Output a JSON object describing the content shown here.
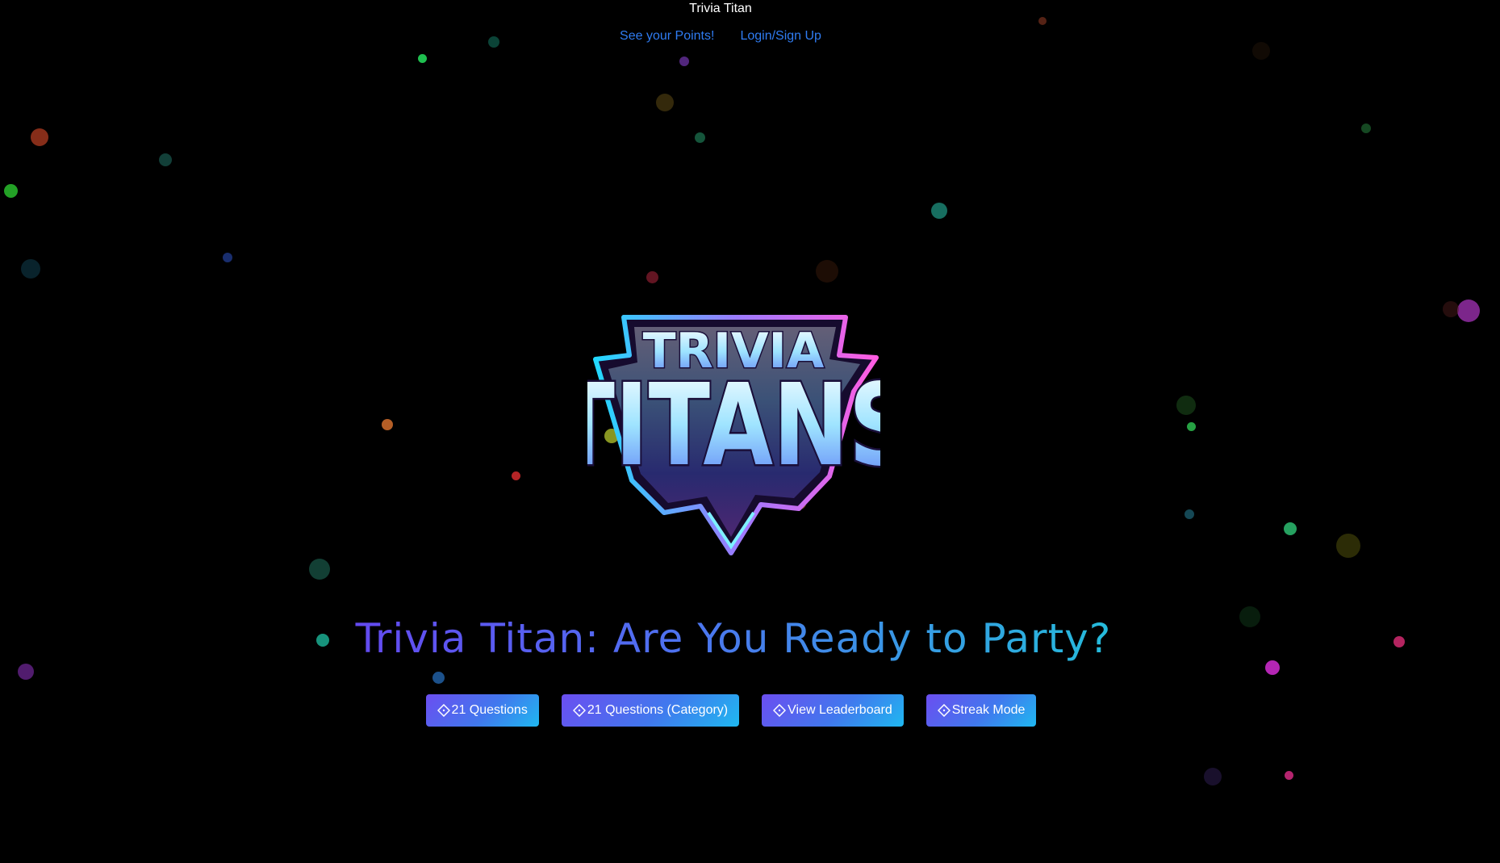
{
  "header": {
    "app_title": "Trivia Titan",
    "nav": [
      {
        "label": "See your Points!"
      },
      {
        "label": "Login/Sign Up"
      }
    ]
  },
  "logo": {
    "line1": "TRIVIA",
    "line2": "TITANS"
  },
  "hero": {
    "headline": "Trivia Titan: Are You Ready to Party?"
  },
  "actions": [
    {
      "label": "21 Questions",
      "icon": "diamond-icon"
    },
    {
      "label": "21 Questions (Category)",
      "icon": "diamond-icon"
    },
    {
      "label": "View Leaderboard",
      "icon": "diamond-icon"
    },
    {
      "label": "Streak Mode",
      "icon": "diamond-icon"
    }
  ],
  "colors": {
    "background": "#000000",
    "link": "#2f7cf2",
    "button_gradient_start": "#6b4ef0",
    "button_gradient_end": "#1fb8f0",
    "headline_gradient_start": "#7b1ff0",
    "headline_gradient_end": "#18d3b3"
  }
}
